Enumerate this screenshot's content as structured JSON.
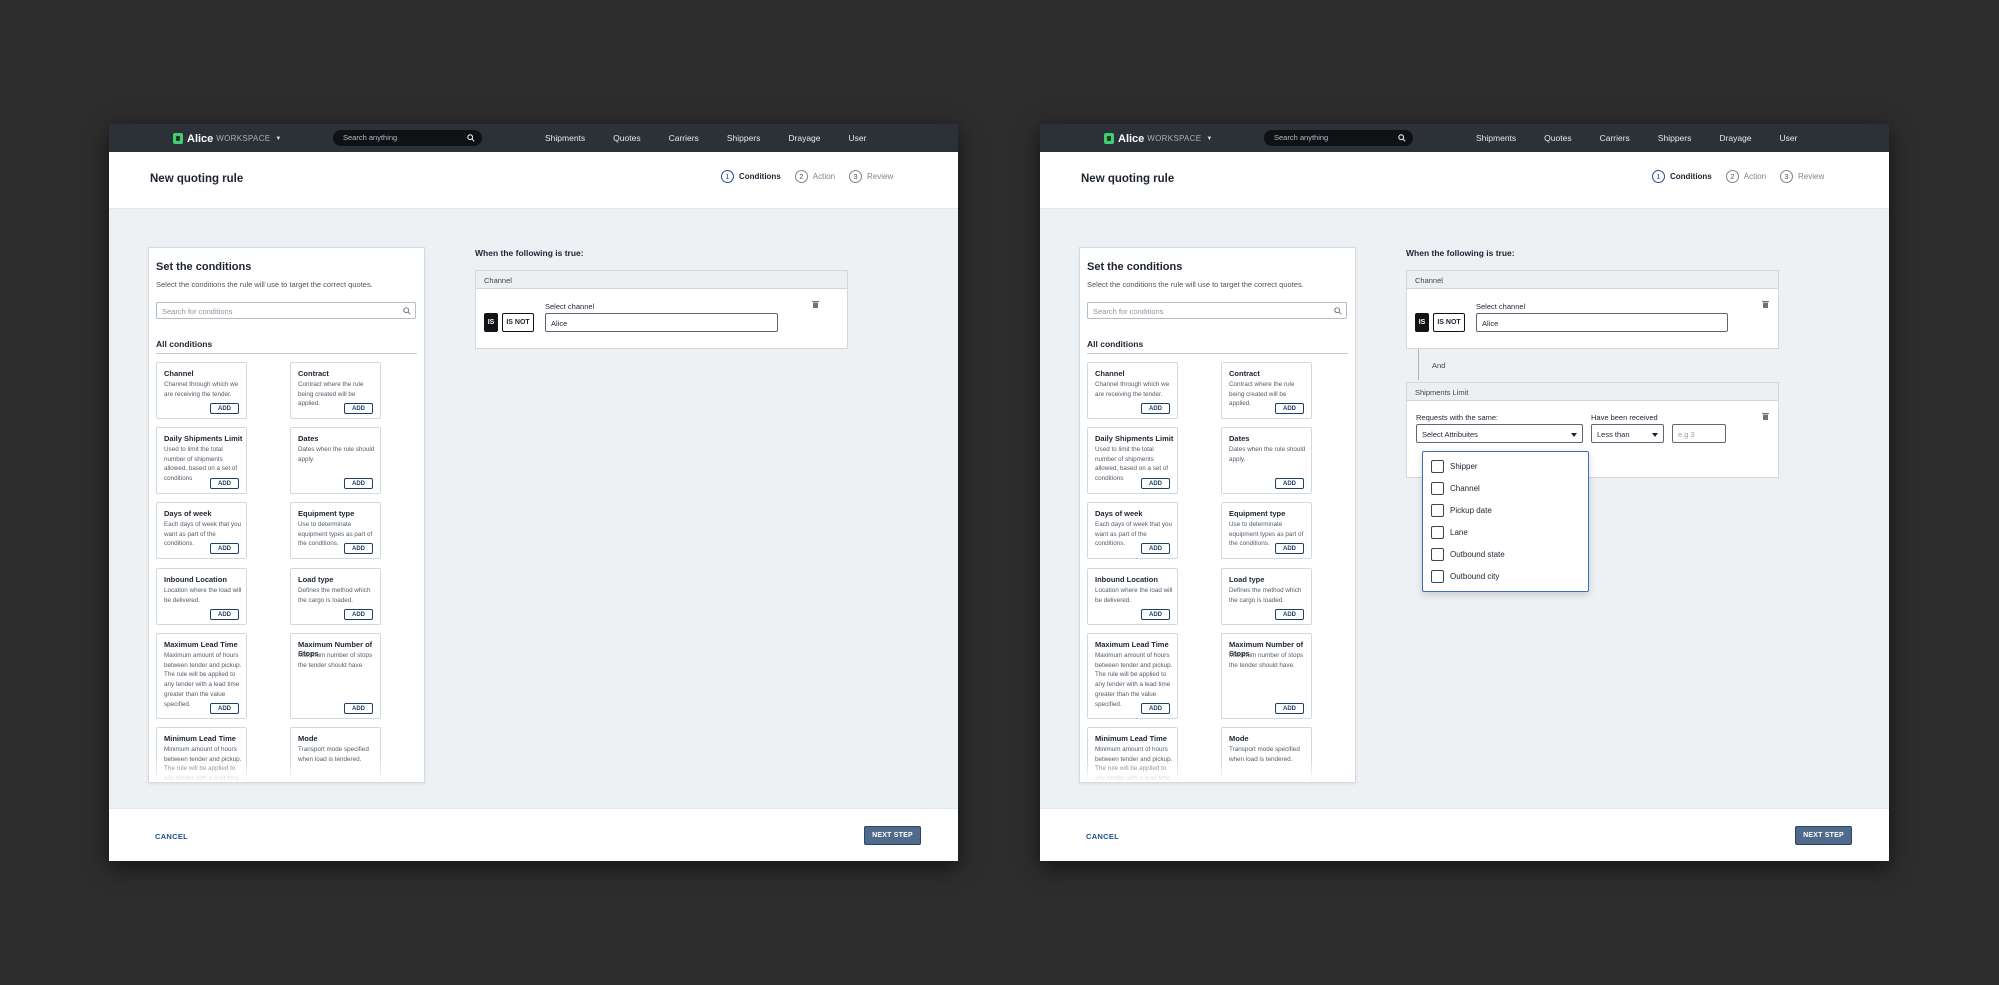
{
  "logo": {
    "name": "Alice",
    "sub": "WORKSPACE"
  },
  "search": {
    "placeholder": "Search anything"
  },
  "nav": [
    "Shipments",
    "Quotes",
    "Carriers",
    "Shippers",
    "Drayage",
    "User"
  ],
  "page_title": "New quoting rule",
  "steps": [
    {
      "num": "1",
      "label": "Conditions",
      "active": true
    },
    {
      "num": "2",
      "label": "Action",
      "active": false
    },
    {
      "num": "3",
      "label": "Review",
      "active": false
    }
  ],
  "conditions_panel": {
    "title": "Set the conditions",
    "description": "Select the conditions the rule will use to target the correct quotes.",
    "search_placeholder": "Search for conditions",
    "all_label": "All conditions",
    "add_label": "ADD",
    "cards": [
      {
        "title": "Channel",
        "desc": "Channel through which we are receiving the tender."
      },
      {
        "title": "Contract",
        "desc": "Contract where the rule being created will be applied."
      },
      {
        "title": "Daily Shipments Limit",
        "desc": "Used to limit the total number of shipments allowed, based on a set of conditions"
      },
      {
        "title": "Dates",
        "desc": "Dates when the rule should apply."
      },
      {
        "title": "Days of week",
        "desc": "Each days of week that you want as part of the conditions."
      },
      {
        "title": "Equipment type",
        "desc": "Use to determinate equipment types as part of the conditions."
      },
      {
        "title": "Inbound Location",
        "desc": "Location where the load will be delivered."
      },
      {
        "title": "Load type",
        "desc": "Defines the method which the cargo is loaded."
      },
      {
        "title": "Maximum Lead Time",
        "desc": "Maximum amount of hours between tender and pickup. The rule will be applied to any tender with a lead time greater than the value specified."
      },
      {
        "title": "Maximum Number of Stops",
        "desc": "Maximum number of stops the tender should have."
      },
      {
        "title": "Minimum Lead Time",
        "desc": "Minimum amount of hours between tender and pickup. The rule will be applied to any tender with a lead time less than the value specified."
      },
      {
        "title": "Mode",
        "desc": "Transport mode specified when load is tendered."
      }
    ]
  },
  "rules": {
    "when_label": "When the following is true:",
    "channel": {
      "head": "Channel",
      "is_label": "IS",
      "isnot_label": "IS NOT",
      "field_label": "Select channel",
      "value": "Alice"
    },
    "and_label": "And",
    "shipments_limit": {
      "head": "Shipments Limit",
      "requests_label": "Requests with the same:",
      "select_value": "Select Attribuites",
      "received_label": "Have been received",
      "comparator_value": "Less than",
      "number_placeholder": "e.g 3",
      "options": [
        "Shipper",
        "Channel",
        "Pickup date",
        "Lane",
        "Outbound state",
        "Outbound city"
      ]
    }
  },
  "footer": {
    "cancel": "CANCEL",
    "next": "NEXT STEP"
  }
}
